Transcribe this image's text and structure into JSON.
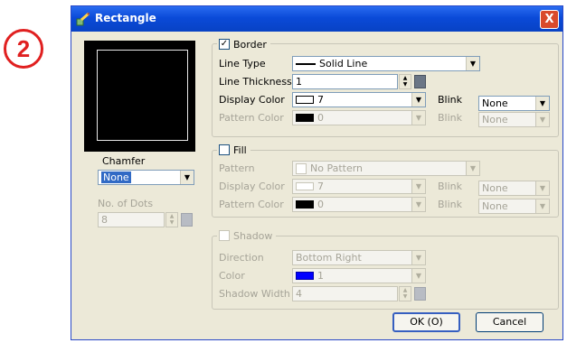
{
  "marker": "2",
  "window": {
    "title": "Rectangle",
    "close": "X"
  },
  "chamfer": {
    "label": "Chamfer",
    "value": "None",
    "dots_label": "No. of Dots",
    "dots_value": "8"
  },
  "border": {
    "label": "Border",
    "checked": true,
    "line_type_label": "Line Type",
    "line_type_value": "Solid Line",
    "line_thickness_label": "Line Thickness",
    "line_thickness_value": "1",
    "display_color_label": "Display Color",
    "display_color_value": "7",
    "display_color_hex": "#ffffff",
    "blink_label": "Blink",
    "blink_value": "None",
    "pattern_color_label": "Pattern Color",
    "pattern_color_value": "0",
    "pattern_color_hex": "#000000",
    "blink2_label": "Blink",
    "blink2_value": "None"
  },
  "fill": {
    "label": "Fill",
    "checked": false,
    "pattern_label": "Pattern",
    "pattern_value": "No Pattern",
    "display_color_label": "Display Color",
    "display_color_value": "7",
    "display_color_hex": "#ffffff",
    "blink_label": "Blink",
    "blink_value": "None",
    "pattern_color_label": "Pattern Color",
    "pattern_color_value": "0",
    "pattern_color_hex": "#000000",
    "blink2_label": "Blink",
    "blink2_value": "None"
  },
  "shadow": {
    "label": "Shadow",
    "checked": false,
    "direction_label": "Direction",
    "direction_value": "Bottom Right",
    "color_label": "Color",
    "color_value": "1",
    "color_hex": "#0000ff",
    "width_label": "Shadow Width",
    "width_value": "4"
  },
  "buttons": {
    "ok": "OK (O)",
    "cancel": "Cancel"
  },
  "colors": {
    "title_bar": "#0a4ad8",
    "dialog_bg": "#ece9d8",
    "marker": "#e02020",
    "selection": "#316ac5"
  }
}
